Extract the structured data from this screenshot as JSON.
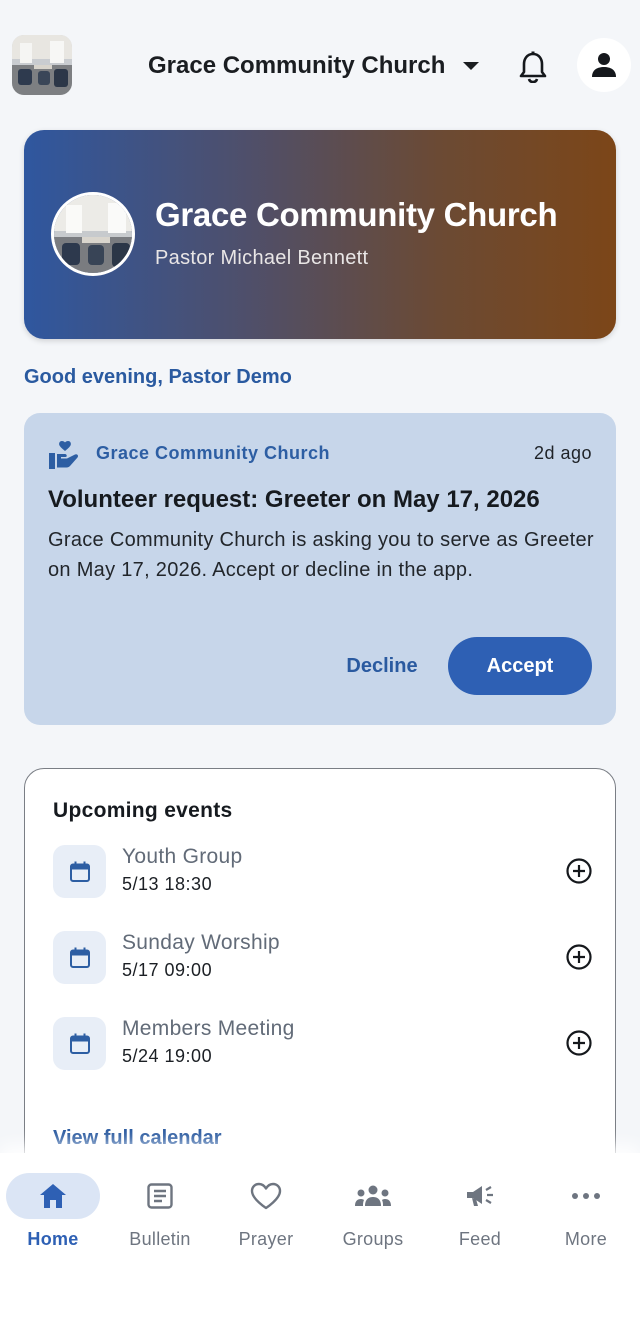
{
  "header": {
    "church_name": "Grace Community Church"
  },
  "hero": {
    "title": "Grace Community Church",
    "subtitle": "Pastor Michael Bennett",
    "gradient": [
      "#2f579f",
      "#7c4618"
    ]
  },
  "greeting": "Good evening, Pastor Demo",
  "notification": {
    "source": "Grace Community Church",
    "time": "2d ago",
    "title": "Volunteer request: Greeter on May 17, 2026",
    "body": "Grace Community Church is asking you to serve as Greeter on May 17, 2026. Accept or decline in the app.",
    "decline_label": "Decline",
    "accept_label": "Accept",
    "icon": "volunteer-hand-heart-icon"
  },
  "events": {
    "title": "Upcoming events",
    "items": [
      {
        "name": "Youth Group",
        "time": "5/13 18:30"
      },
      {
        "name": "Sunday Worship",
        "time": "5/17 09:00"
      },
      {
        "name": "Members Meeting",
        "time": "5/24 19:00"
      }
    ],
    "view_all_label": "View full calendar"
  },
  "nav": {
    "items": [
      {
        "label": "Home",
        "icon": "home-icon",
        "active": true
      },
      {
        "label": "Bulletin",
        "icon": "bulletin-icon"
      },
      {
        "label": "Prayer",
        "icon": "heart-icon"
      },
      {
        "label": "Groups",
        "icon": "groups-icon"
      },
      {
        "label": "Feed",
        "icon": "megaphone-icon"
      },
      {
        "label": "More",
        "icon": "more-icon"
      }
    ]
  },
  "colors": {
    "accent": "#2e60b4",
    "link": "#2a5aa0",
    "card": "#c7d6ea",
    "background": "#f4f6f9"
  }
}
